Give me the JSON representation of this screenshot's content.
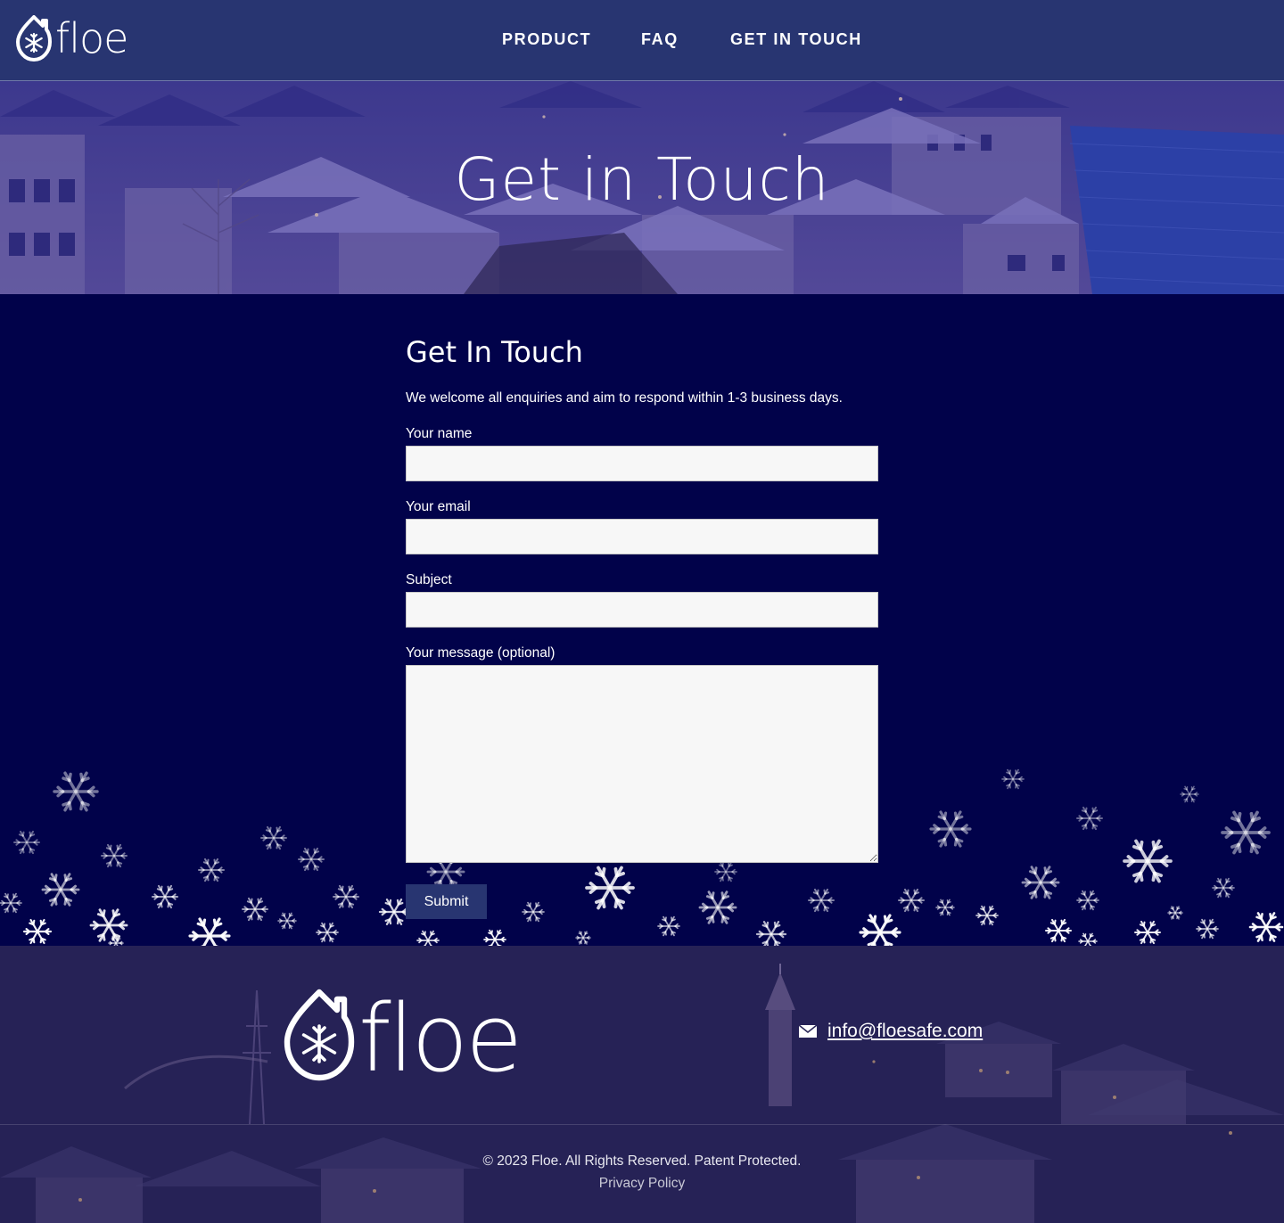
{
  "header": {
    "logo_text": "floe",
    "nav": [
      {
        "label": "PRODUCT"
      },
      {
        "label": "FAQ"
      },
      {
        "label": "GET IN TOUCH"
      }
    ]
  },
  "hero": {
    "title": "Get in Touch"
  },
  "form": {
    "heading": "Get In Touch",
    "intro": "We welcome all enquiries and aim to respond within 1-3 business days.",
    "fields": [
      {
        "label": "Your name",
        "value": ""
      },
      {
        "label": "Your email",
        "value": ""
      },
      {
        "label": "Subject",
        "value": ""
      },
      {
        "label": "Your message (optional)",
        "value": ""
      }
    ],
    "submit_label": "Submit"
  },
  "footer": {
    "logo_text": "floe",
    "email": "info@floesafe.com",
    "copyright": "© 2023 Floe. All Rights Reserved. Patent Protected.",
    "privacy_label": "Privacy Policy"
  },
  "colors": {
    "header_bg": "#283571",
    "section_bg": "#01024a",
    "button_bg": "#283571",
    "input_bg": "#f7f7f7"
  }
}
